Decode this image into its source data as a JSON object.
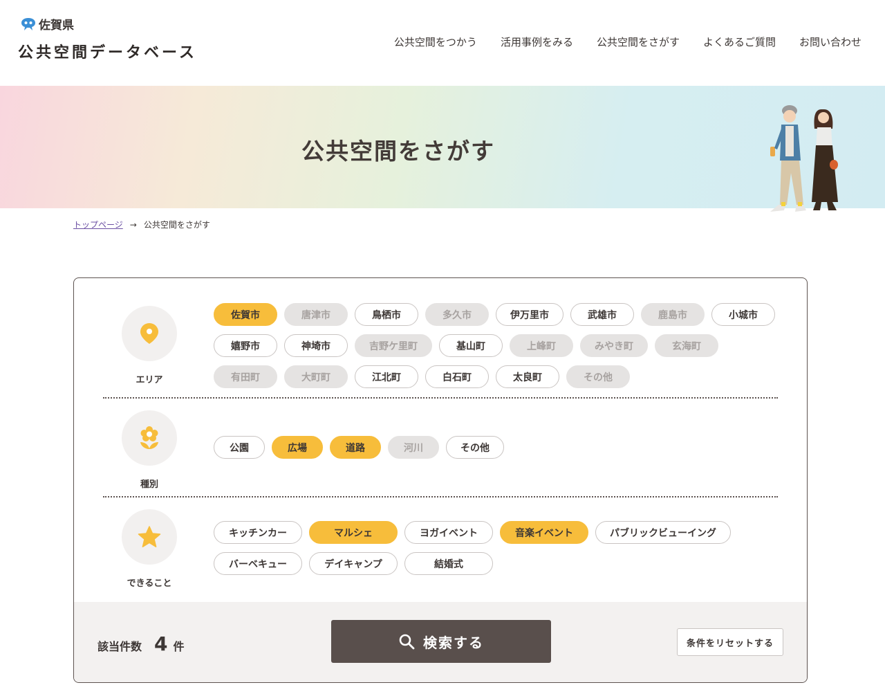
{
  "header": {
    "prefecture": "佐賀県",
    "site_title": "公共空間データベース",
    "nav": [
      "公共空間をつかう",
      "活用事例をみる",
      "公共空間をさがす",
      "よくあるご質問",
      "お問い合わせ"
    ]
  },
  "hero": {
    "title": "公共空間をさがす"
  },
  "breadcrumb": {
    "home": "トップページ",
    "arrow": "→",
    "current": "公共空間をさがす"
  },
  "filters": {
    "area": {
      "label": "エリア",
      "icon": "map-pin-icon",
      "options": [
        {
          "label": "佐賀市",
          "state": "selected"
        },
        {
          "label": "唐津市",
          "state": "disabled"
        },
        {
          "label": "鳥栖市",
          "state": "default"
        },
        {
          "label": "多久市",
          "state": "disabled"
        },
        {
          "label": "伊万里市",
          "state": "default"
        },
        {
          "label": "武雄市",
          "state": "default"
        },
        {
          "label": "鹿島市",
          "state": "disabled"
        },
        {
          "label": "小城市",
          "state": "default"
        },
        {
          "label": "嬉野市",
          "state": "default"
        },
        {
          "label": "神埼市",
          "state": "default"
        },
        {
          "label": "吉野ケ里町",
          "state": "disabled"
        },
        {
          "label": "基山町",
          "state": "default"
        },
        {
          "label": "上峰町",
          "state": "disabled"
        },
        {
          "label": "みやき町",
          "state": "disabled"
        },
        {
          "label": "玄海町",
          "state": "disabled"
        },
        {
          "label": "有田町",
          "state": "disabled"
        },
        {
          "label": "大町町",
          "state": "disabled"
        },
        {
          "label": "江北町",
          "state": "default"
        },
        {
          "label": "白石町",
          "state": "default"
        },
        {
          "label": "太良町",
          "state": "default"
        },
        {
          "label": "その他",
          "state": "disabled"
        }
      ]
    },
    "type": {
      "label": "種別",
      "icon": "flower-icon",
      "options": [
        {
          "label": "公園",
          "state": "default"
        },
        {
          "label": "広場",
          "state": "selected"
        },
        {
          "label": "道路",
          "state": "selected"
        },
        {
          "label": "河川",
          "state": "disabled"
        },
        {
          "label": "その他",
          "state": "default"
        }
      ]
    },
    "can_do": {
      "label": "できること",
      "icon": "star-icon",
      "options": [
        {
          "label": "キッチンカー",
          "state": "default"
        },
        {
          "label": "マルシェ",
          "state": "selected"
        },
        {
          "label": "ヨガイベント",
          "state": "default"
        },
        {
          "label": "音楽イベント",
          "state": "selected"
        },
        {
          "label": "パブリックビューイング",
          "state": "default"
        },
        {
          "label": "バーベキュー",
          "state": "default"
        },
        {
          "label": "デイキャンプ",
          "state": "default"
        },
        {
          "label": "結婚式",
          "state": "default"
        }
      ]
    }
  },
  "result": {
    "label": "該当件数",
    "count": "4",
    "unit": "件"
  },
  "actions": {
    "search": "検索する",
    "reset": "条件をリセットする"
  },
  "colors": {
    "accent": "#f7bd3b",
    "dark": "#594f4c",
    "text": "#3d3735",
    "disabled_bg": "#e5e3e2",
    "link": "#6b4fa3"
  }
}
